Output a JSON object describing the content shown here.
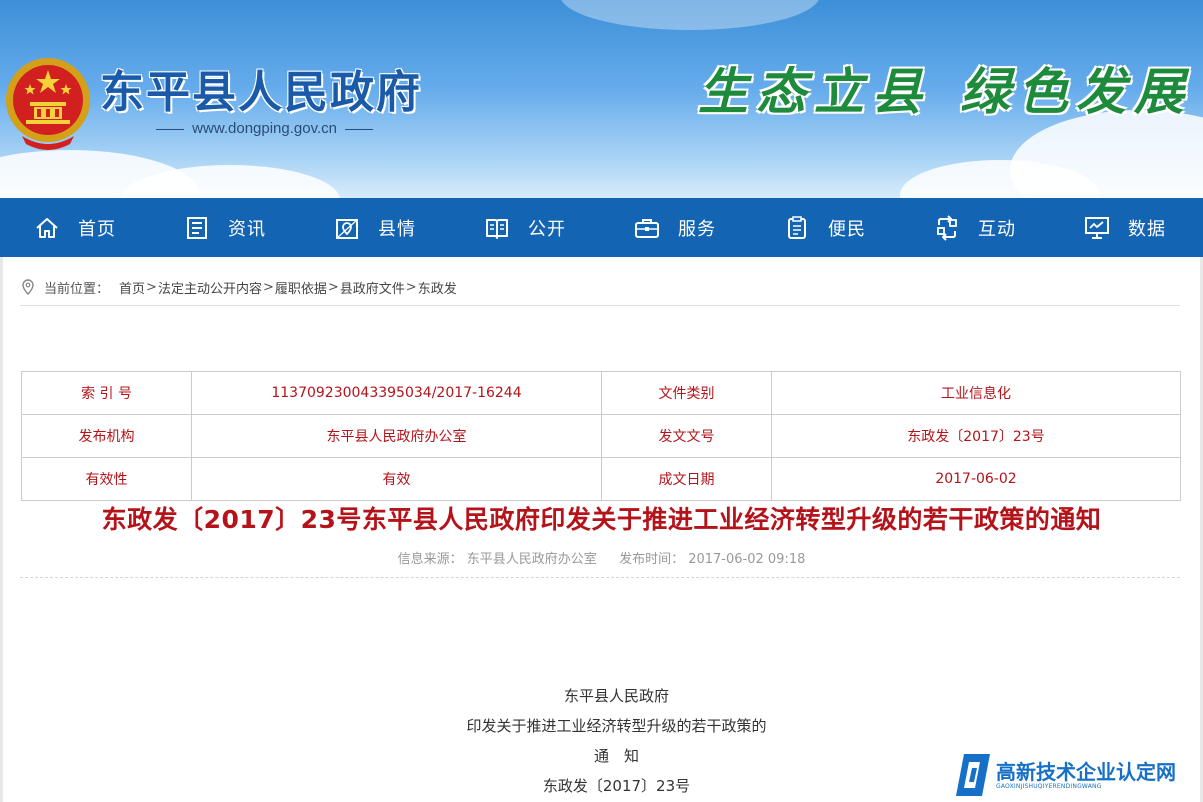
{
  "header": {
    "site_title": "东平县人民政府",
    "site_url": "www.dongping.gov.cn",
    "slogan_part1": "生态立县",
    "slogan_part2": "绿色发展"
  },
  "nav": [
    {
      "label": "首页",
      "icon": "home-icon"
    },
    {
      "label": "资讯",
      "icon": "news-icon"
    },
    {
      "label": "县情",
      "icon": "map-icon"
    },
    {
      "label": "公开",
      "icon": "book-icon"
    },
    {
      "label": "服务",
      "icon": "briefcase-icon"
    },
    {
      "label": "便民",
      "icon": "clipboard-icon"
    },
    {
      "label": "互动",
      "icon": "interaction-icon"
    },
    {
      "label": "数据",
      "icon": "monitor-icon"
    }
  ],
  "breadcrumb": {
    "label": "当前位置：",
    "items": [
      "首页",
      "法定主动公开内容",
      "履职依据",
      "县政府文件",
      "东政发"
    ],
    "separator": ">"
  },
  "meta_table": {
    "rows": [
      {
        "k1": "索 引 号",
        "v1": "113709230043395034/2017-16244",
        "k2": "文件类别",
        "v2": "工业信息化"
      },
      {
        "k1": "发布机构",
        "v1": "东平县人民政府办公室",
        "k2": "发文文号",
        "v2": "东政发〔2017〕23号"
      },
      {
        "k1": "有效性",
        "v1": "有效",
        "k2": "成文日期",
        "v2": "2017-06-02"
      }
    ]
  },
  "document": {
    "title": "东政发〔2017〕23号东平县人民政府印发关于推进工业经济转型升级的若干政策的通知",
    "source_label": "信息来源：",
    "source_value": "东平县人民政府办公室",
    "time_label": "发布时间：",
    "time_value": "2017-06-02 09:18",
    "body_lines": [
      "东平县人民政府",
      "印发关于推进工业经济转型升级的若干政策的",
      "通　知",
      "东政发〔2017〕23号"
    ]
  },
  "watermark": {
    "title": "高新技术企业认定网",
    "subtitle": "GAOXINJISHUQIYERENDINGWANG"
  },
  "colors": {
    "nav_bg": "#1464b4",
    "title_red": "#b5131a",
    "brand_blue": "#1a5aa8",
    "slogan_green": "#1e8a3c"
  }
}
